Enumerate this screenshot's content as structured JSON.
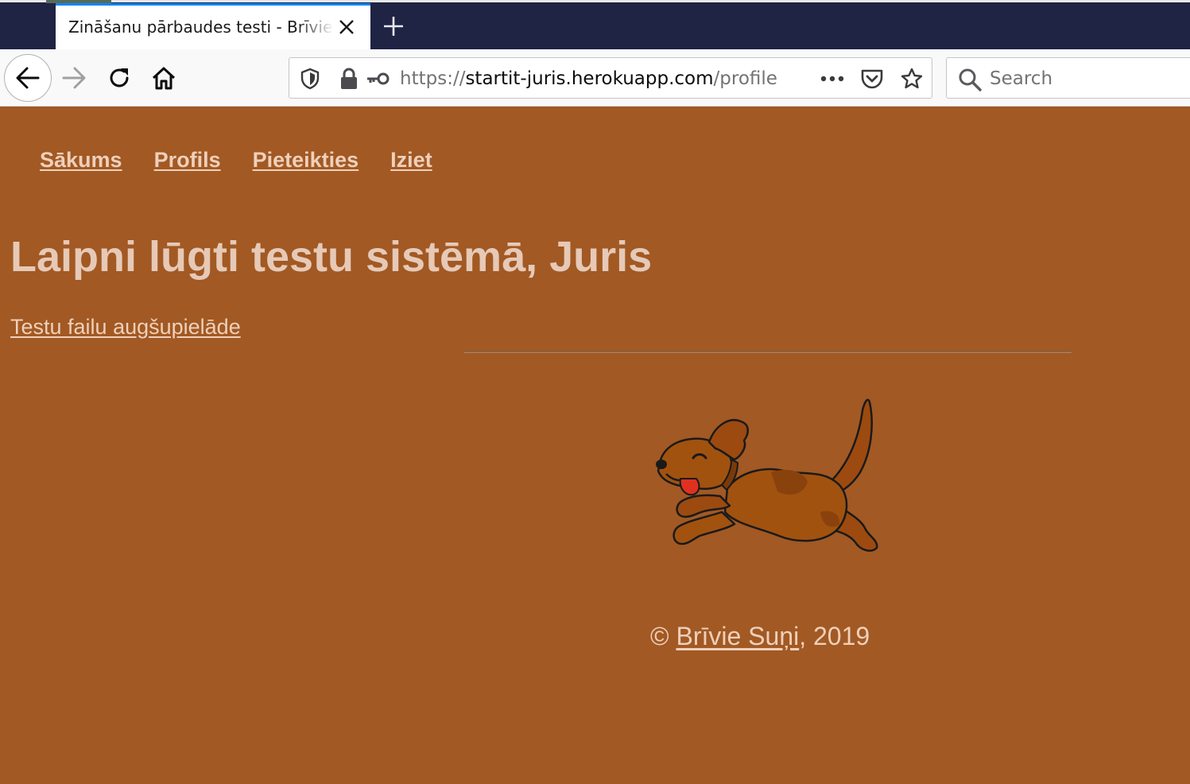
{
  "browser": {
    "tab_title": "Zināšanu pārbaudes testi - Brīvie Suņi",
    "url_scheme": "https://",
    "url_host": "startit-juris.herokuapp.com",
    "url_path": "/profile",
    "search_placeholder": "Search",
    "accent_color": "#0a84ff"
  },
  "page": {
    "background_color": "#a25923",
    "nav": [
      {
        "label": "Sākums"
      },
      {
        "label": "Profils"
      },
      {
        "label": "Pieteikties"
      },
      {
        "label": "Iziet"
      }
    ],
    "headline": "Laipni lūgti testu sistēmā, Juris",
    "upload_link": "Testu failu augšupielāde",
    "footer": {
      "copyright_symbol": "©",
      "link_text": "Brīvie Suņi",
      "year_text": ", 2019"
    },
    "dog_image": "running-dog-illustration"
  }
}
